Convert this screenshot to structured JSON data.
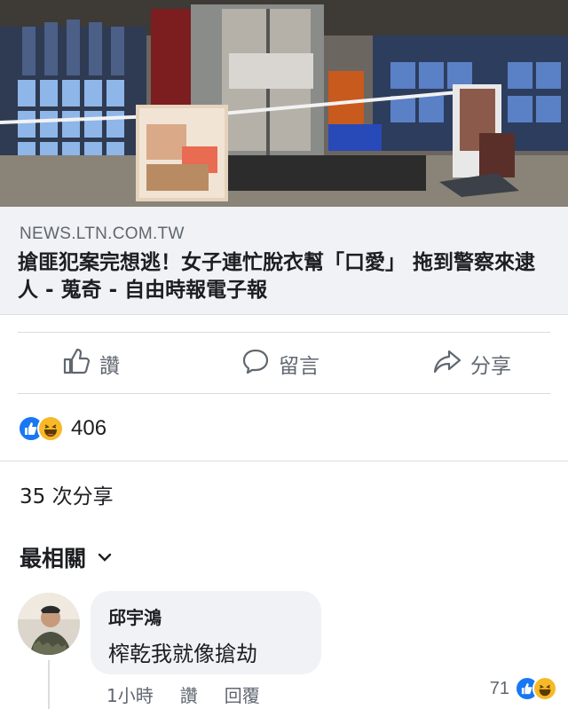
{
  "link_preview": {
    "image_alt": "",
    "domain": "NEWS.LTN.COM.TW",
    "title": "搶匪犯案完想逃！女子連忙脫衣幫「口愛」 拖到警察來逮人 - 蒐奇 - 自由時報電子報"
  },
  "actions": {
    "like_label": "讚",
    "comment_label": "留言",
    "share_label": "分享"
  },
  "reactions": {
    "icons": [
      "like-icon",
      "haha-icon"
    ],
    "count": "406"
  },
  "shares_text": "35 次分享",
  "comments_sort": {
    "label": "最相關",
    "icon": "chevron-down-icon"
  },
  "comment": {
    "author": "邱宇鴻",
    "text": "榨乾我就像搶劫",
    "time": "1小時",
    "like_label": "讚",
    "reply_label": "回覆",
    "reaction_count": "71"
  },
  "colors": {
    "link_box_bg": "#f0f2f5",
    "muted_text": "#606770",
    "like_blue": "#1877f2",
    "haha_yellow": "#f7b928"
  }
}
